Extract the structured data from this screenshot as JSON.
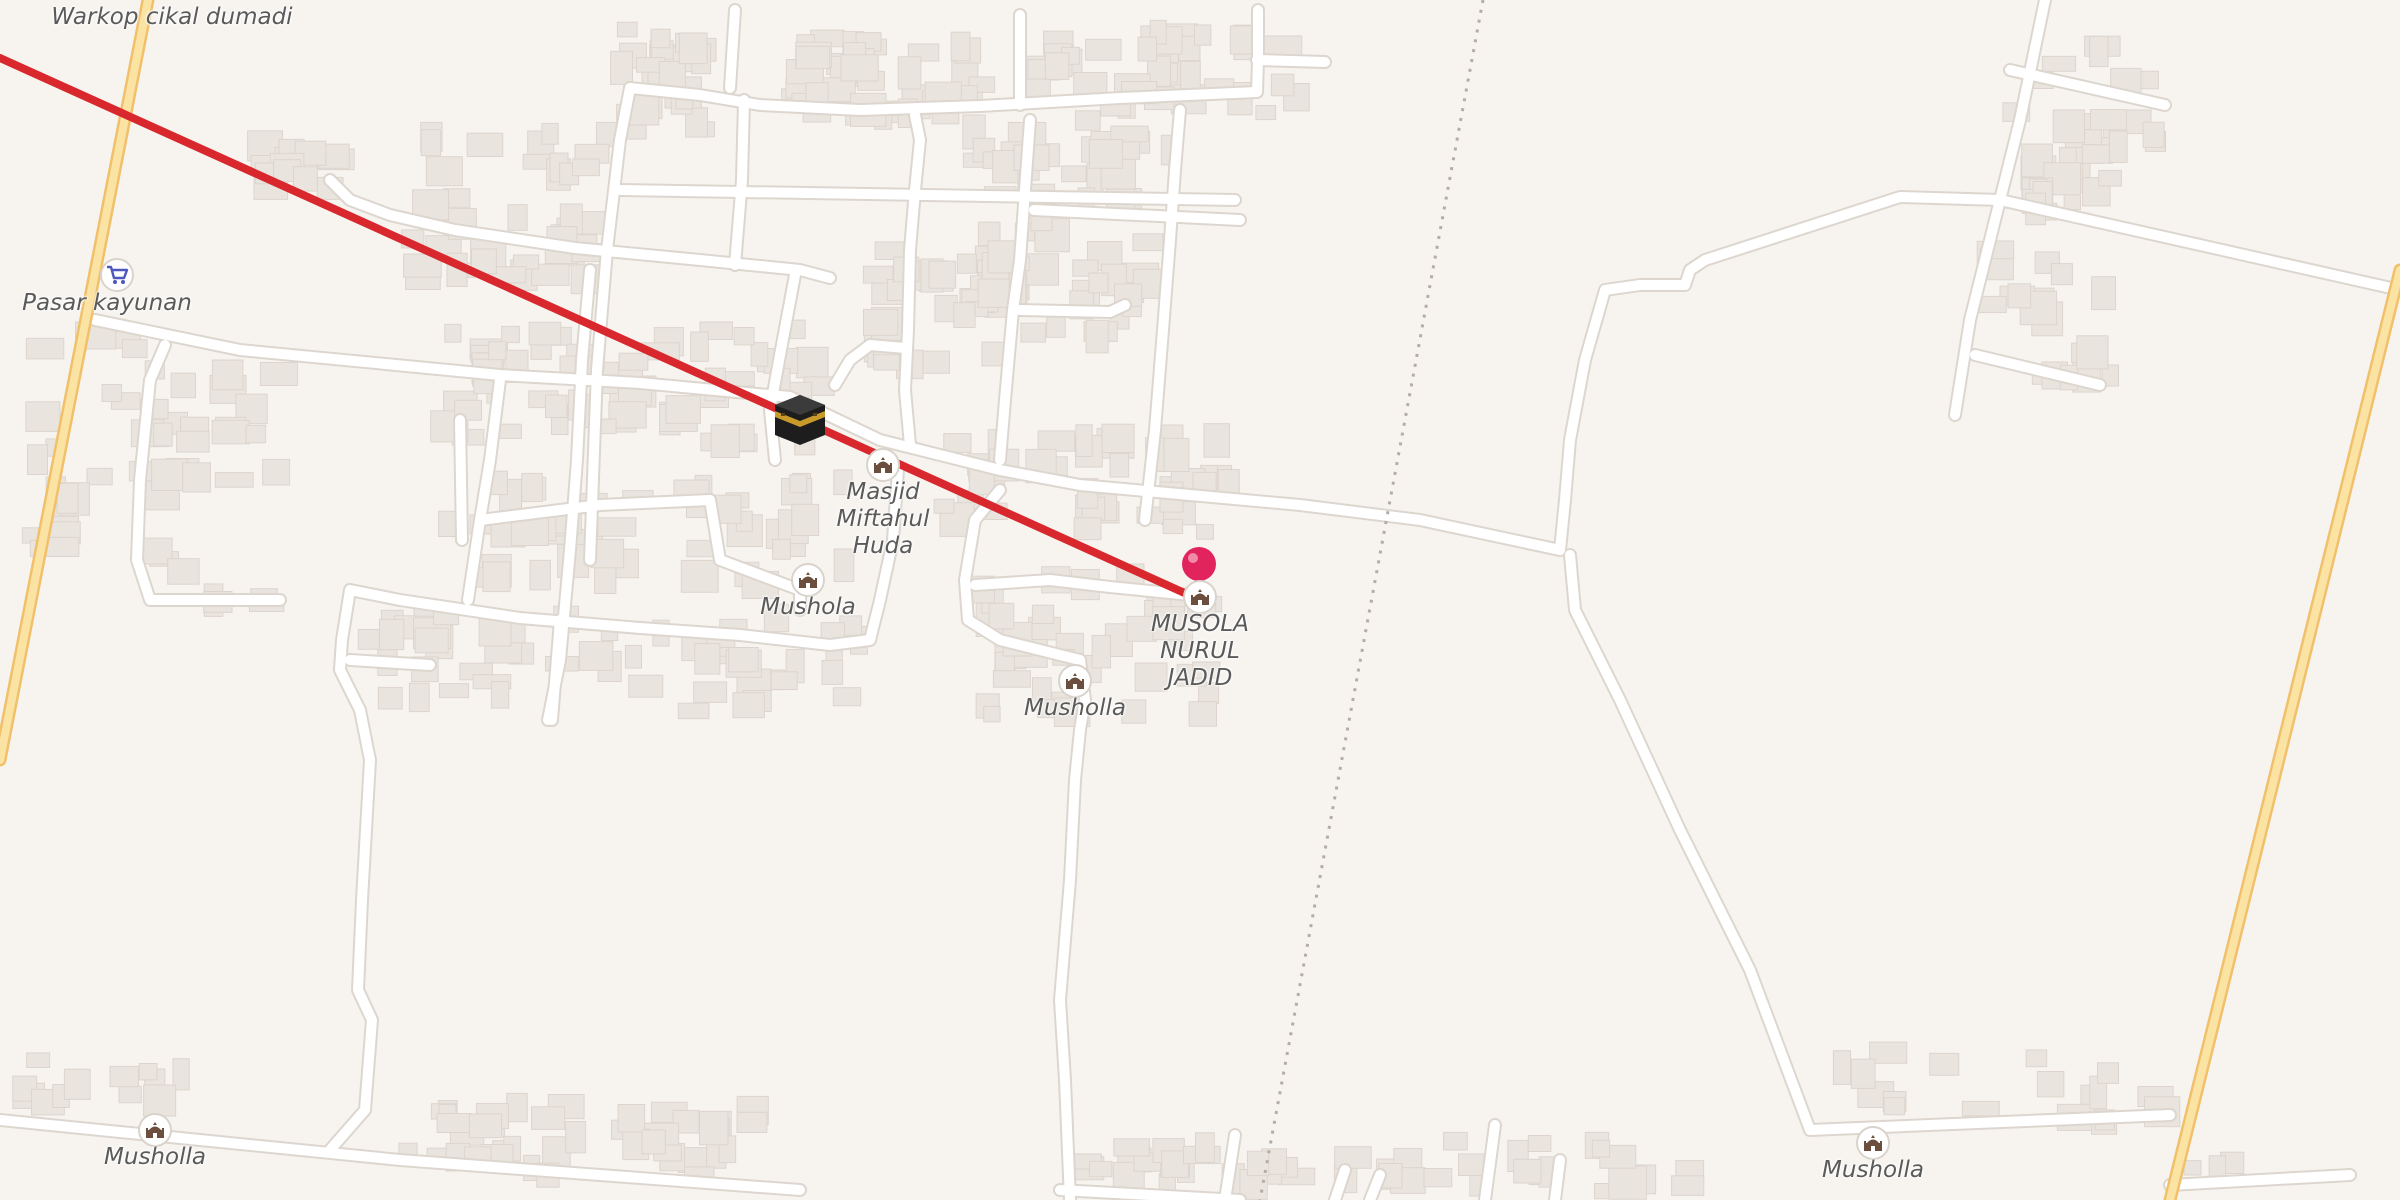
{
  "map": {
    "colors": {
      "background": "#f7f4f0",
      "road": "#ffffff",
      "road_casing": "#ddd6cf",
      "major_road": "#fbe3a4",
      "major_road_casing": "#f1c06b",
      "building": "#e9e4de",
      "route": "#d8282d",
      "pin": "#e2245c"
    },
    "route_icon": "kaaba-icon",
    "selected_pin_icon": "map-pin-icon",
    "pois": [
      {
        "icon": "mosque-icon",
        "label": "Musholla"
      },
      {
        "icon": "mosque-icon",
        "label": "Mushola"
      },
      {
        "icon": "mosque-icon",
        "label": "Masjid Miftahul Huda"
      },
      {
        "icon": "mosque-icon",
        "label": "Musholla"
      },
      {
        "icon": "mosque-icon",
        "label": "MUSOLA NURUL JADID"
      },
      {
        "icon": "mosque-icon",
        "label": "Musholla"
      },
      {
        "icon": "shopping-cart-icon",
        "label": "Pasar kayunan"
      }
    ],
    "places": [
      {
        "label": "Warkop cikal dumadi"
      }
    ]
  }
}
